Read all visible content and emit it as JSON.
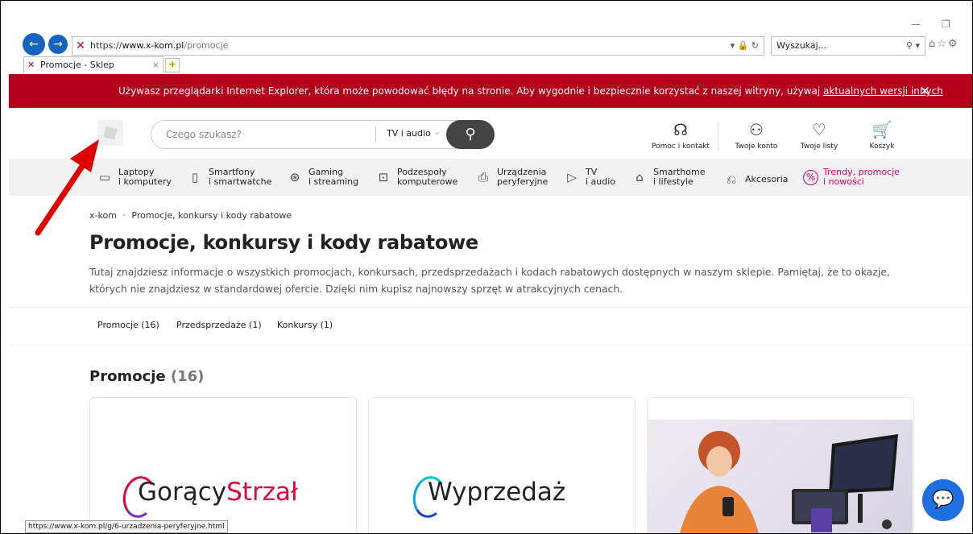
{
  "browser": {
    "url_scheme": "https://",
    "url_domain": "www.x-kom.pl",
    "url_path": "/promocje",
    "search_placeholder": "Wyszukaj...",
    "tab_title": "Promocje - Sklep komputer...",
    "tab_close": "×",
    "status_url": "https://www.x-kom.pl/g/6-urzadzenia-peryferyjne.html"
  },
  "banner": {
    "text": "Używasz przeglądarki Internet Explorer, która może powodować błędy na stronie. Aby wygodnie i bezpiecznie korzystać z naszej witryny, używaj ",
    "link": "aktualnych wersji innych przeglądarek.",
    "close": "×"
  },
  "header": {
    "search_placeholder": "Czego szukasz?",
    "search_category": "TV i audio",
    "icons": [
      {
        "label": "Pomoc i kontakt",
        "icon": "headset-icon"
      },
      {
        "label": "Twoje konto",
        "icon": "user-icon"
      },
      {
        "label": "Twoje listy",
        "icon": "heart-icon"
      },
      {
        "label": "Koszyk",
        "icon": "cart-icon"
      }
    ]
  },
  "categories": [
    {
      "l1": "Laptopy",
      "l2": "i komputery"
    },
    {
      "l1": "Smartfony",
      "l2": "i smartwatche"
    },
    {
      "l1": "Gaming",
      "l2": "i streaming"
    },
    {
      "l1": "Podzespoły",
      "l2": "komputerowe"
    },
    {
      "l1": "Urządzenia",
      "l2": "peryferyjne"
    },
    {
      "l1": "TV",
      "l2": "i audio"
    },
    {
      "l1": "Smarthome",
      "l2": "i lifestyle"
    },
    {
      "l1": "Akcesoria",
      "l2": ""
    },
    {
      "l1": "Trendy, promocje",
      "l2": "i nowości"
    }
  ],
  "breadcrumb": {
    "home": "x-kom",
    "current": "Promocje, konkursy i kody rabatowe"
  },
  "page": {
    "title": "Promocje, konkursy i kody rabatowe",
    "description": "Tutaj znajdziesz informacje o wszystkich promocjach, konkursach, przedsprzedażach i kodach rabatowych dostępnych w naszym sklepie. Pamiętaj, że to okazje, których nie znajdziesz w standardowej ofercie. Dzięki nim kupisz najnowszy sprzęt w atrakcyjnych cenach."
  },
  "tabs": [
    {
      "label": "Promocje (16)"
    },
    {
      "label": "Przedsprzedaże (1)"
    },
    {
      "label": "Konkursy (1)"
    }
  ],
  "section": {
    "title": "Promocje",
    "count": "(16)"
  },
  "cards": [
    {
      "brand_a": "Gorący",
      "brand_b": "Strzał"
    },
    {
      "brand_a": "Wyprzedaż",
      "brand_b": ""
    }
  ],
  "colors": {
    "brand_red": "#b5001a",
    "accent_pink": "#d4006a",
    "chat_blue": "#1e6fe0"
  }
}
